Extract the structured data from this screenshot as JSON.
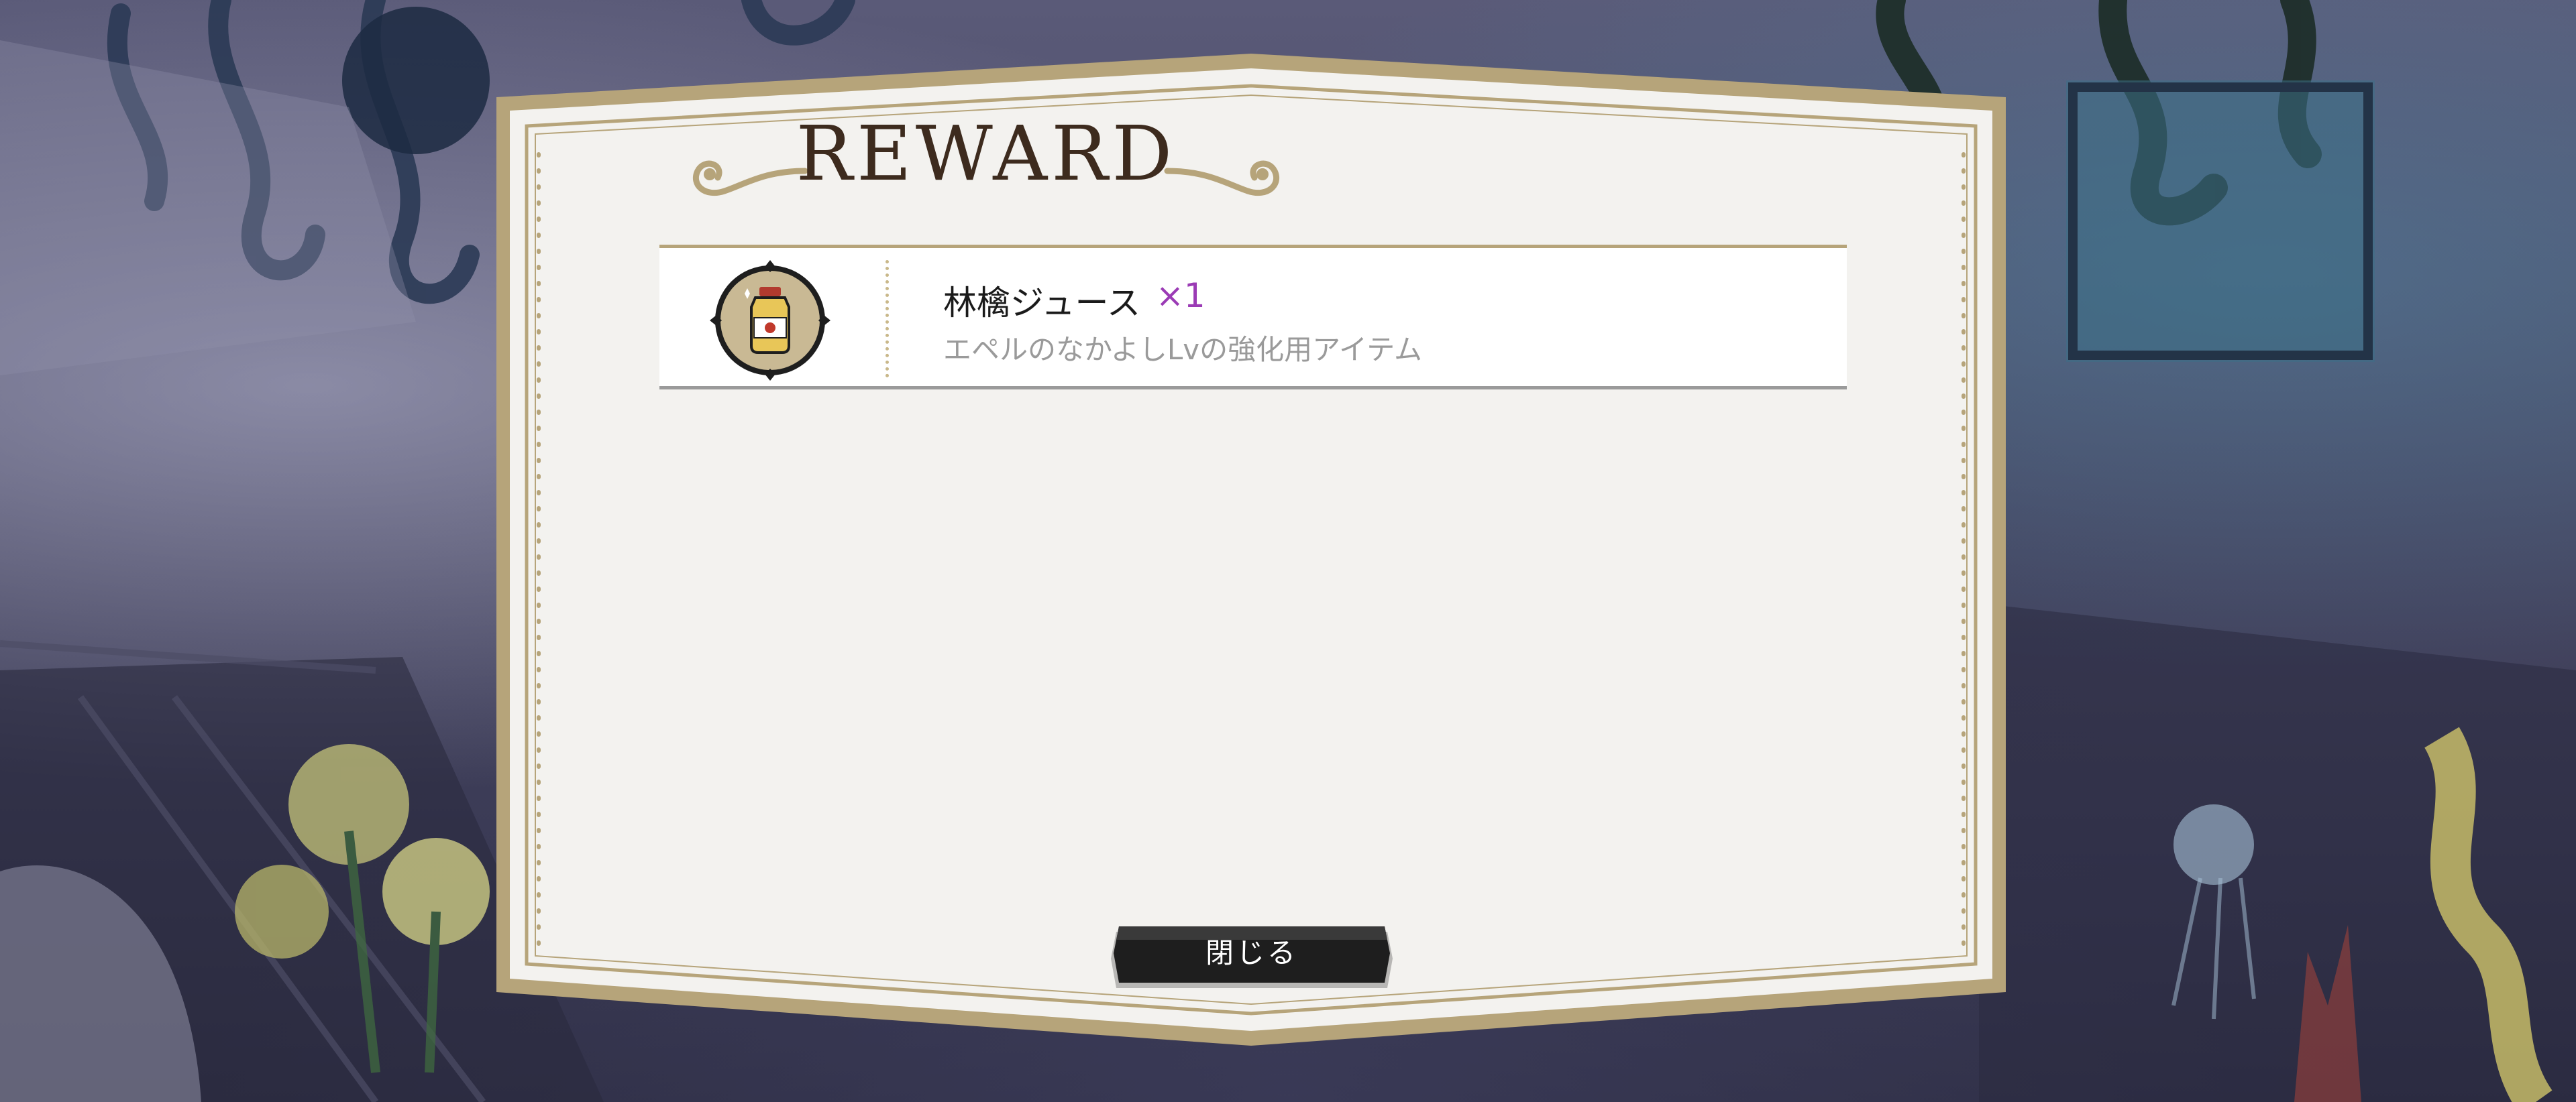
{
  "panel": {
    "title": "REWARD"
  },
  "reward": {
    "item_name": "林檎ジュース",
    "quantity": "×1",
    "description": "エペルのなかよしLvの強化用アイテム",
    "icon": "apple-juice-bottle-icon"
  },
  "close_button": {
    "label": "閉じる"
  },
  "colors": {
    "frame_gold": "#b6a47a",
    "panel_bg": "#f3f2ef",
    "quantity_purple": "#9b3bb5",
    "button_dark": "#1e1e1e"
  }
}
